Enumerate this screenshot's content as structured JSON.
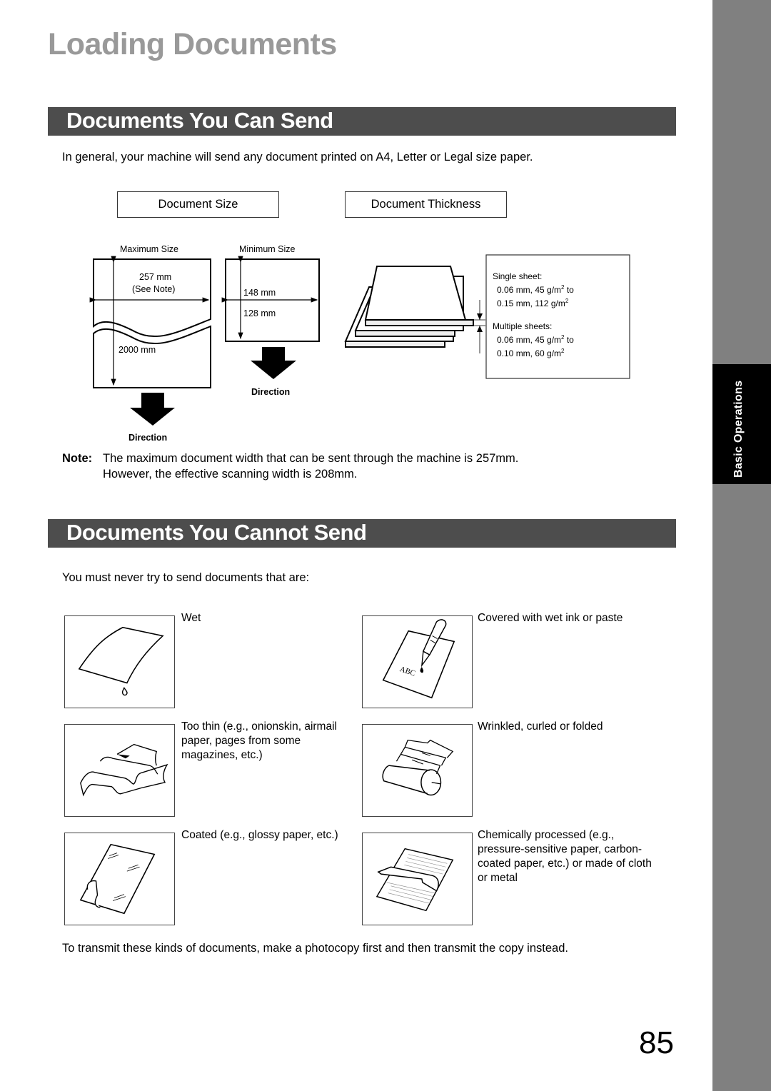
{
  "page": {
    "title": "Loading Documents",
    "page_number": "85",
    "side_tab": "Basic Operations"
  },
  "can_send": {
    "heading": "Documents You Can Send",
    "intro": "In general, your machine will send any document printed on A4, Letter or Legal size paper.",
    "size_label": "Document Size",
    "thickness_label": "Document Thickness",
    "max": {
      "label": "Maximum Size",
      "width": "257 mm",
      "width_note": "(See Note)",
      "length": "2000 mm",
      "direction": "Direction"
    },
    "min": {
      "label": "Minimum Size",
      "width": "148 mm",
      "length": "128 mm",
      "direction": "Direction"
    },
    "thickness": {
      "single_label": "Single sheet:",
      "single_line1": "0.06 mm, 45 g/m",
      "single_line1_suffix": " to",
      "single_line2": "0.15 mm, 112 g/m",
      "multi_label": "Multiple sheets:",
      "multi_line1": "0.06 mm, 45 g/m",
      "multi_line1_suffix": " to",
      "multi_line2": "0.10 mm, 60 g/m",
      "superscript": "2"
    },
    "note_label": "Note:",
    "note_line1": "The maximum document width that can be sent through the machine is 257mm.",
    "note_line2": "However, the effective scanning width is 208mm."
  },
  "cannot_send": {
    "heading": "Documents You Cannot Send",
    "intro": "You must never try to send documents that are:",
    "items": [
      {
        "icon": "wet-paper-icon",
        "text": "Wet"
      },
      {
        "icon": "wet-ink-pen-icon",
        "text": "Covered with wet ink or paste",
        "illustration_text": "ABC"
      },
      {
        "icon": "thin-paper-icon",
        "text": "Too thin (e.g., onionskin, airmail paper, pages from some magazines, etc.)"
      },
      {
        "icon": "wrinkled-paper-icon",
        "text": "Wrinkled, curled or folded"
      },
      {
        "icon": "coated-paper-icon",
        "text": "Coated (e.g., glossy paper, etc.)"
      },
      {
        "icon": "chemical-paper-icon",
        "text": "Chemically processed (e.g., pressure-sensitive paper, carbon-coated paper, etc.) or made of cloth or metal"
      }
    ],
    "footer": "To transmit these kinds of documents, make a photocopy first and then transmit the copy instead."
  }
}
